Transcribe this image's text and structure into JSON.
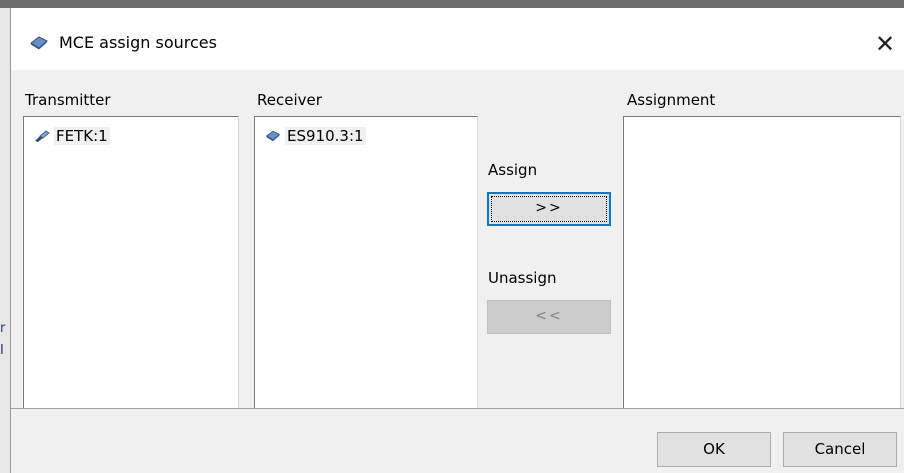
{
  "dialog": {
    "title": "MCE assign sources",
    "close_icon": "close-icon"
  },
  "columns": {
    "transmitter_label": "Transmitter",
    "receiver_label": "Receiver",
    "assignment_label": "Assignment"
  },
  "transmitter": {
    "items": [
      {
        "label": "FETK:1",
        "icon": "probe-icon"
      }
    ]
  },
  "receiver": {
    "items": [
      {
        "label": "ES910.3:1",
        "icon": "device-module-icon"
      }
    ]
  },
  "assignment": {
    "items": []
  },
  "actions": {
    "assign_label": "Assign",
    "assign_button": ">>",
    "unassign_label": "Unassign",
    "unassign_button": "<<"
  },
  "footer": {
    "ok": "OK",
    "cancel": "Cancel"
  },
  "colors": {
    "focus_border": "#0078d7",
    "selection_bg": "#f0f0f0",
    "disabled_button": "#cccccc"
  }
}
